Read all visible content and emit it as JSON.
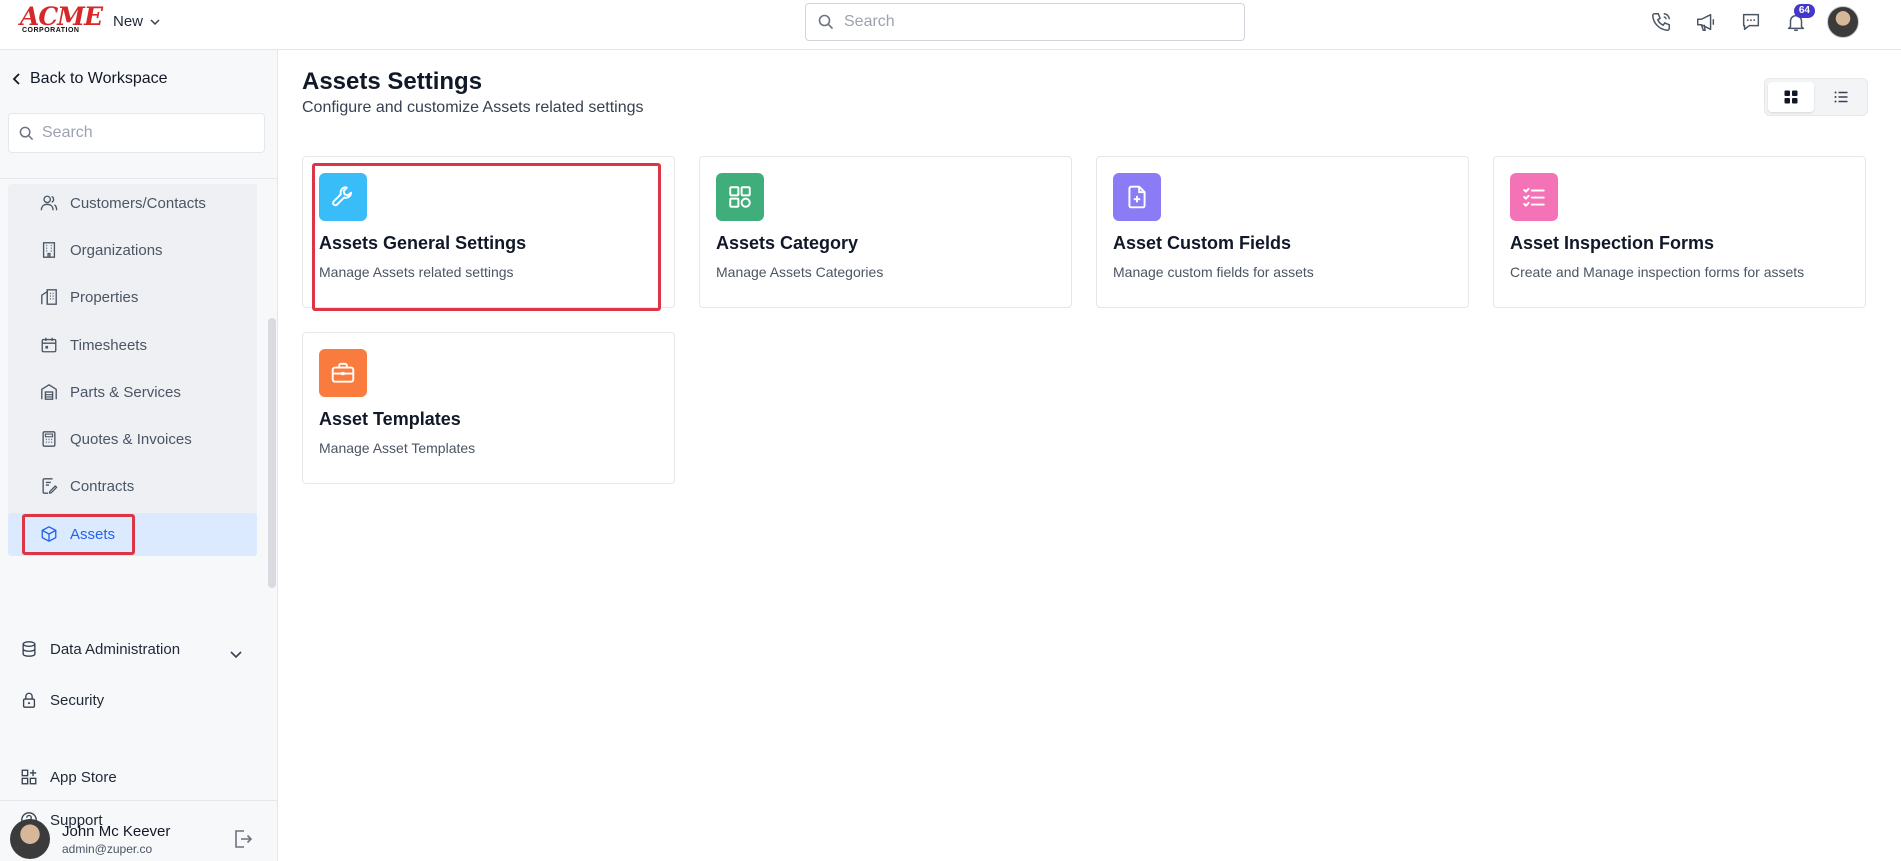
{
  "header": {
    "logo_text": "ACME",
    "logo_sub": "CORPORATION",
    "new_label": "New",
    "search_placeholder": "Search",
    "notification_count": "64"
  },
  "sidebar": {
    "back_label": "Back to Workspace",
    "search_placeholder": "Search",
    "items": [
      {
        "label": "Customers/Contacts",
        "icon": "users-icon"
      },
      {
        "label": "Organizations",
        "icon": "building-icon"
      },
      {
        "label": "Properties",
        "icon": "property-icon"
      },
      {
        "label": "Timesheets",
        "icon": "calendar-icon"
      },
      {
        "label": "Parts & Services",
        "icon": "warehouse-icon"
      },
      {
        "label": "Quotes & Invoices",
        "icon": "calculator-icon"
      },
      {
        "label": "Contracts",
        "icon": "contract-icon"
      },
      {
        "label": "Assets",
        "icon": "cube-icon"
      }
    ],
    "data_admin_label": "Data Administration",
    "security_label": "Security",
    "app_store_label": "App Store",
    "support_label": "Support",
    "user": {
      "name": "John Mc Keever",
      "email": "admin@zuper.co"
    }
  },
  "main": {
    "title": "Assets Settings",
    "subtitle": "Configure and customize Assets related settings",
    "cards": [
      {
        "title": "Assets General Settings",
        "desc": "Manage Assets related settings",
        "icon": "wrench-icon",
        "color": "#38bdf8"
      },
      {
        "title": "Assets Category",
        "desc": "Manage Assets Categories",
        "icon": "grid-icon",
        "color": "#3fae7a"
      },
      {
        "title": "Asset Custom Fields",
        "desc": "Manage custom fields for assets",
        "icon": "file-plus-icon",
        "color": "#8b7cf6"
      },
      {
        "title": "Asset Inspection Forms",
        "desc": "Create and Manage inspection forms for assets",
        "icon": "checklist-icon",
        "color": "#f472b6"
      },
      {
        "title": "Asset Templates",
        "desc": "Manage Asset Templates",
        "icon": "briefcase-icon",
        "color": "#f97b3d"
      }
    ]
  }
}
